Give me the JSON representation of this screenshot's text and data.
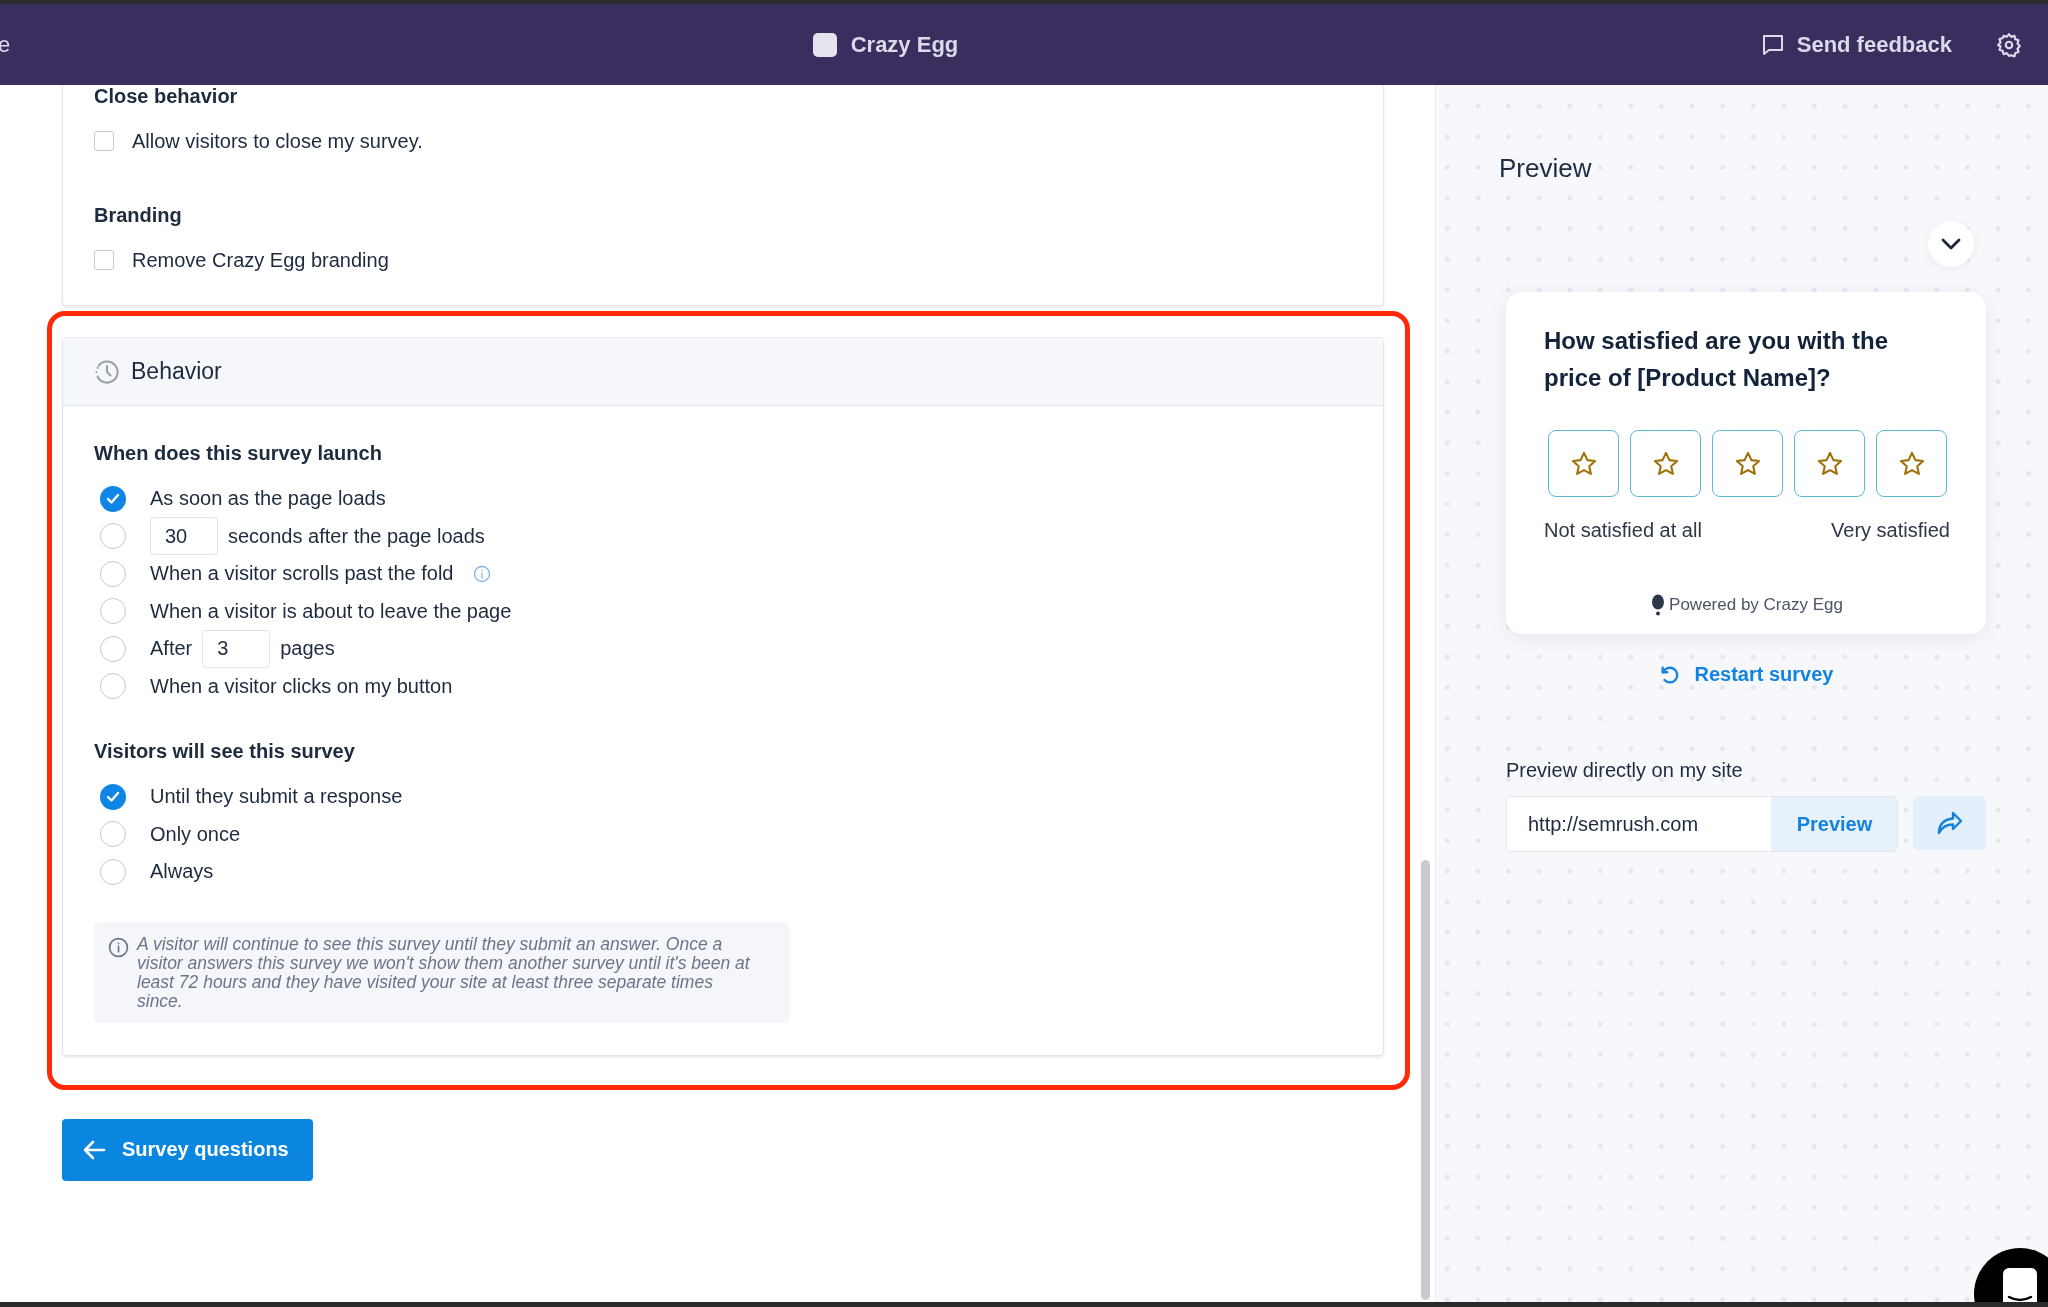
{
  "header": {
    "left_fragment": "e",
    "title": "Crazy Egg",
    "feedback": "Send feedback"
  },
  "display_card": {
    "sections": [
      {
        "heading": "Close behavior",
        "options": [
          {
            "label": "Allow visitors to close my survey.",
            "checked": false
          }
        ]
      },
      {
        "heading": "Branding",
        "options": [
          {
            "label": "Remove Crazy Egg branding",
            "checked": false
          }
        ]
      }
    ]
  },
  "behavior": {
    "title": "Behavior",
    "highlighted": true,
    "groups": [
      {
        "heading": "When does this survey launch",
        "options": [
          {
            "selected": true,
            "info": false,
            "parts": [
              {
                "kind": "text",
                "text": "As soon as the page loads"
              }
            ]
          },
          {
            "selected": false,
            "info": false,
            "parts": [
              {
                "kind": "input",
                "value": "30"
              },
              {
                "kind": "text",
                "text": "seconds after the page loads"
              }
            ]
          },
          {
            "selected": false,
            "info": true,
            "parts": [
              {
                "kind": "text",
                "text": "When a visitor scrolls past the fold"
              }
            ]
          },
          {
            "selected": false,
            "info": false,
            "parts": [
              {
                "kind": "text",
                "text": "When a visitor is about to leave the page"
              }
            ]
          },
          {
            "selected": false,
            "info": false,
            "parts": [
              {
                "kind": "text",
                "text": "After"
              },
              {
                "kind": "input",
                "value": "3"
              },
              {
                "kind": "text",
                "text": "pages"
              }
            ]
          },
          {
            "selected": false,
            "info": false,
            "parts": [
              {
                "kind": "text",
                "text": "When a visitor clicks on my button"
              }
            ]
          }
        ]
      },
      {
        "heading": "Visitors will see this survey",
        "options": [
          {
            "selected": true,
            "info": false,
            "parts": [
              {
                "kind": "text",
                "text": "Until they submit a response"
              }
            ]
          },
          {
            "selected": false,
            "info": false,
            "parts": [
              {
                "kind": "text",
                "text": "Only once"
              }
            ]
          },
          {
            "selected": false,
            "info": false,
            "parts": [
              {
                "kind": "text",
                "text": "Always"
              }
            ]
          }
        ]
      }
    ],
    "note": "A visitor will continue to see this survey until they submit an answer. Once a visitor answers this survey we won't show them another survey until it's been at least 72 hours and they have visited your site at least three separate times since."
  },
  "back_button": "Survey questions",
  "preview": {
    "title": "Preview",
    "question": "How satisfied are you with the price of [Product Name]?",
    "low_label": "Not satisfied at all",
    "high_label": "Very satisfied",
    "powered_by": "Powered by Crazy Egg",
    "restart": "Restart survey",
    "site_label": "Preview directly on my site",
    "url": "http://semrush.com",
    "preview_button": "Preview"
  }
}
